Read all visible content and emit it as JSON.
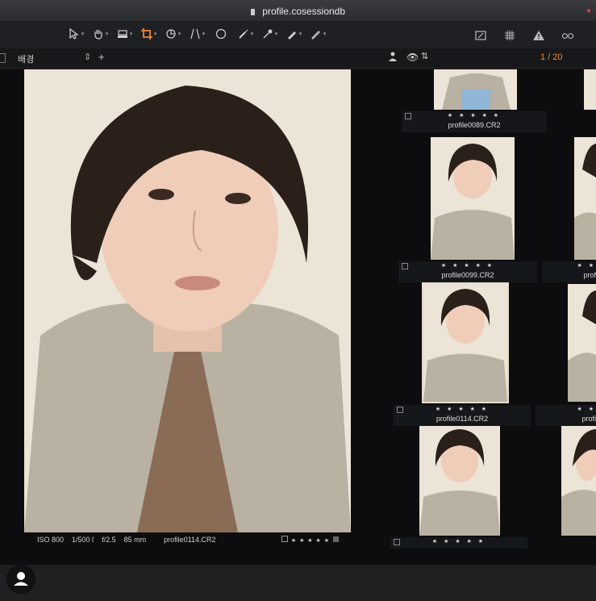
{
  "window": {
    "title": "profile.cosessiondb"
  },
  "browser": {
    "header_label": "배경",
    "counter": "1 / 20"
  },
  "viewer": {
    "iso": "ISO 800",
    "shutter": "1/500 ſ",
    "aperture": "f/2.5",
    "focal": "85 mm",
    "filename": "profile0114.CR2",
    "stars": "★ ★ ★ ★ ★"
  },
  "thumbnails": [
    {
      "filename": "profile0089.CR2",
      "stars": "★ ★ ★ ★ ★"
    },
    {
      "filename": "profile0099.CR2",
      "stars": "★ ★ ★ ★ ★"
    },
    {
      "filename": "profile0114.CR2",
      "stars": "★ ★ ★ ★ ★",
      "selected": true
    },
    {
      "filename": "",
      "stars": "★ ★ ★ ★ ★"
    }
  ],
  "side_thumbnails": [
    {
      "filename": "prof",
      "stars": "★ ★"
    },
    {
      "filename": "profi",
      "stars": "★ ★"
    }
  ],
  "colors": {
    "accent": "#f0872f",
    "background": "#0d0d0f",
    "photo_backdrop": "#ece4d6"
  }
}
